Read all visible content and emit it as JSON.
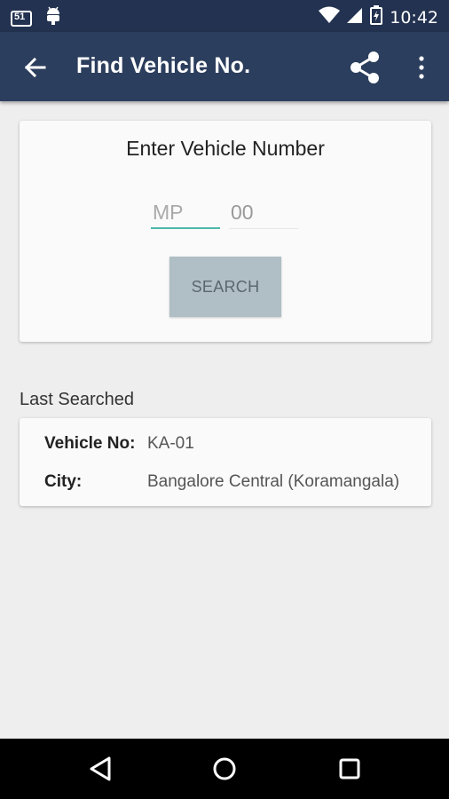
{
  "status_bar": {
    "time": "10:42",
    "icons": [
      "notification-badge-icon",
      "android-icon",
      "wifi-icon",
      "signal-icon",
      "battery-icon"
    ],
    "badge_text": "51"
  },
  "app_bar": {
    "title": "Find Vehicle No.",
    "back_icon": "arrow-left-icon",
    "share_icon": "share-icon",
    "more_icon": "more-vert-icon",
    "color": "#2c3e5d"
  },
  "search_card": {
    "heading": "Enter Vehicle Number",
    "state_placeholder": "MP",
    "state_value": "",
    "rto_placeholder": "00",
    "rto_value": "",
    "search_label": "SEARCH",
    "accent": "#4db6ac",
    "button_color": "#b0bec5"
  },
  "last_searched": {
    "title": "Last Searched",
    "vehicle_label": "Vehicle No:",
    "vehicle_value": "KA-01",
    "city_label": "City:",
    "city_value": "Bangalore Central (Koramangala)"
  },
  "nav_bar": {
    "icons": [
      "back-triangle-icon",
      "home-circle-icon",
      "recents-square-icon"
    ]
  }
}
